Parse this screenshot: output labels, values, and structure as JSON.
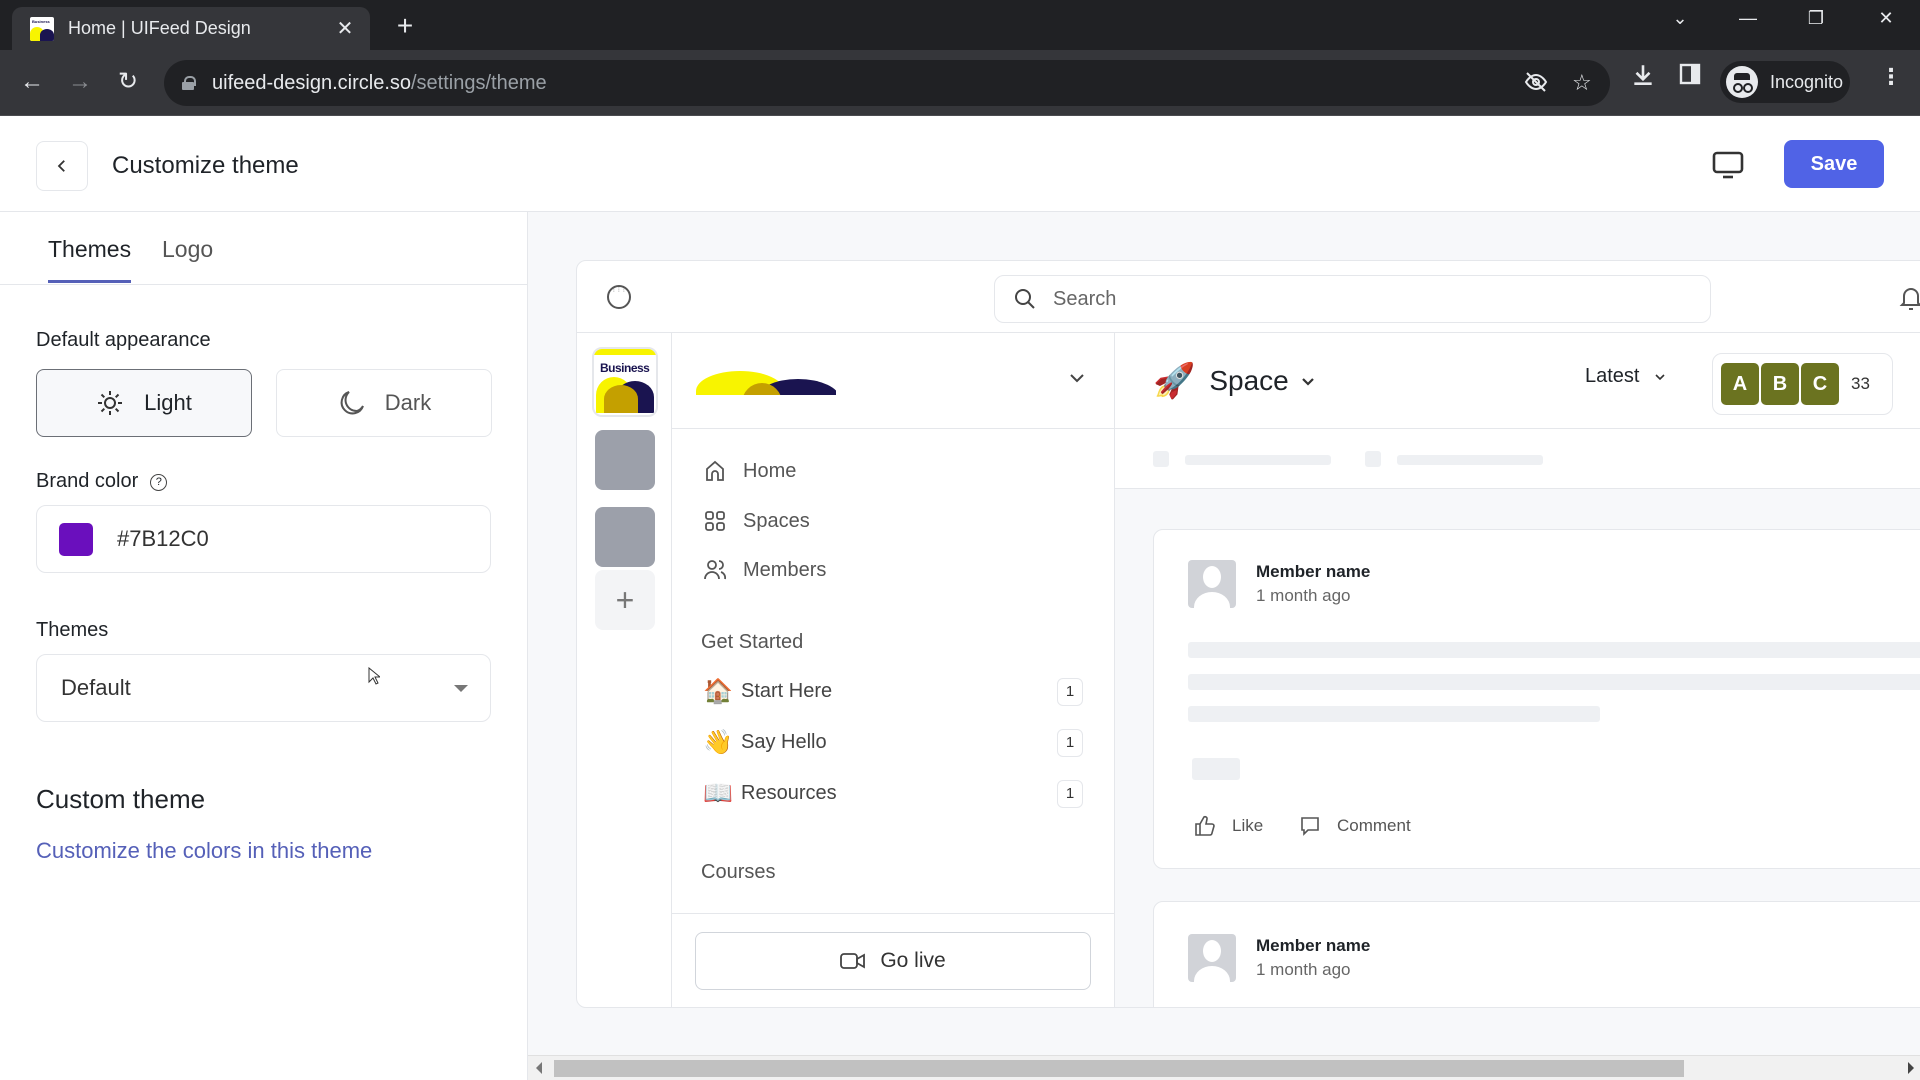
{
  "browser": {
    "tab_title": "Home | UIFeed Design",
    "favicon_text": "Business",
    "url_host": "uifeed-design.circle.so",
    "url_path": "/settings/theme",
    "profile_label": "Incognito"
  },
  "header": {
    "title": "Customize theme",
    "save_label": "Save"
  },
  "settings": {
    "tabs": [
      {
        "label": "Themes",
        "active": true
      },
      {
        "label": "Logo",
        "active": false
      }
    ],
    "appearance_label": "Default appearance",
    "appearance_options": [
      {
        "label": "Light",
        "selected": true
      },
      {
        "label": "Dark",
        "selected": false
      }
    ],
    "brand_color_label": "Brand color",
    "brand_color_help": "?",
    "brand_color_value": "#7B12C0",
    "brand_color_hex": "#6a0fbd",
    "themes_label": "Themes",
    "themes_selected": "Default",
    "custom_theme_title": "Custom theme",
    "custom_theme_link": "Customize the colors in this theme"
  },
  "preview": {
    "search_placeholder": "Search",
    "rail_logo_text": "Business",
    "nav": [
      {
        "label": "Home",
        "icon": "home-icon"
      },
      {
        "label": "Spaces",
        "icon": "grid-icon"
      },
      {
        "label": "Members",
        "icon": "users-icon"
      }
    ],
    "group_label": "Get Started",
    "spaces": [
      {
        "emoji": "🏠",
        "label": "Start Here",
        "count": "1"
      },
      {
        "emoji": "👋",
        "label": "Say Hello",
        "count": "1"
      },
      {
        "emoji": "📖",
        "label": "Resources",
        "count": "1"
      }
    ],
    "courses_label": "Courses",
    "golive_label": "Go live",
    "space_emoji": "🚀",
    "space_title": "Space",
    "sort_label": "Latest",
    "member_avatars": [
      "A",
      "B",
      "C"
    ],
    "member_avatar_color": "#6b7320",
    "member_count": "33",
    "posts": [
      {
        "name": "Member name",
        "time": "1 month ago",
        "like_label": "Like",
        "comment_label": "Comment"
      },
      {
        "name": "Member name",
        "time": "1 month ago"
      }
    ]
  },
  "colors": {
    "accent": "#5063e6",
    "link": "#5560b8"
  }
}
